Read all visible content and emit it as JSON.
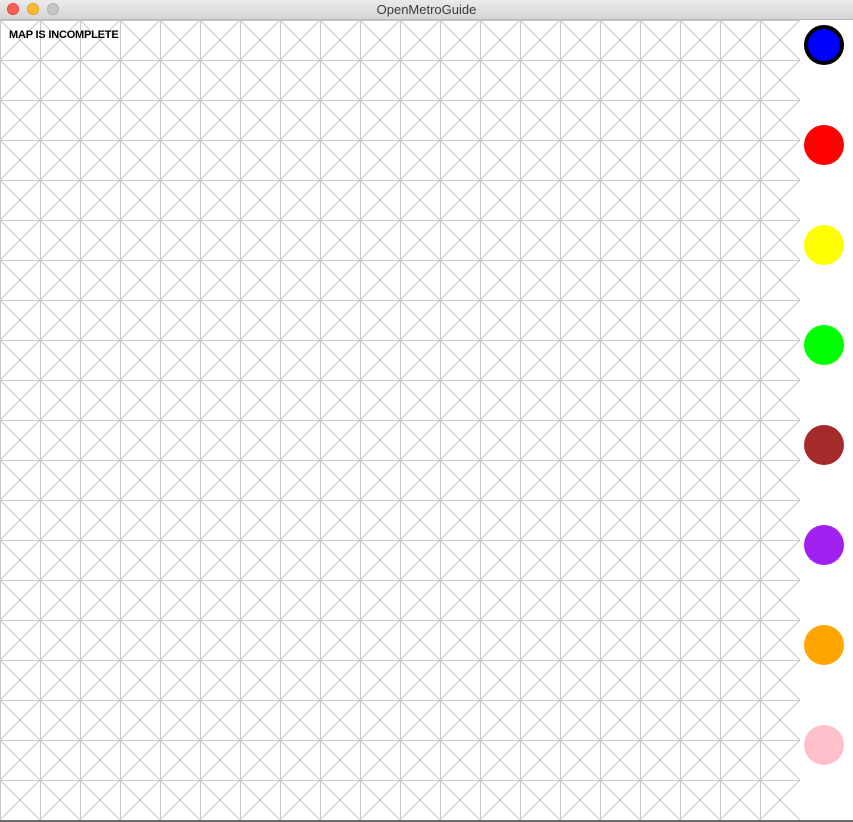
{
  "window": {
    "title": "OpenMetroGuide"
  },
  "map": {
    "status_message": "MAP IS INCOMPLETE",
    "grid_line_color": "#c8c8c8"
  },
  "palette": {
    "selected": "blue",
    "colors": [
      {
        "name": "blue",
        "hex": "#0000ff"
      },
      {
        "name": "red",
        "hex": "#ff0000"
      },
      {
        "name": "yellow",
        "hex": "#ffff00"
      },
      {
        "name": "green",
        "hex": "#00ff00"
      },
      {
        "name": "brown",
        "hex": "#a52a2a"
      },
      {
        "name": "purple",
        "hex": "#a020f0"
      },
      {
        "name": "orange",
        "hex": "#ffa500"
      },
      {
        "name": "pink",
        "hex": "#ffc0cb"
      }
    ]
  }
}
